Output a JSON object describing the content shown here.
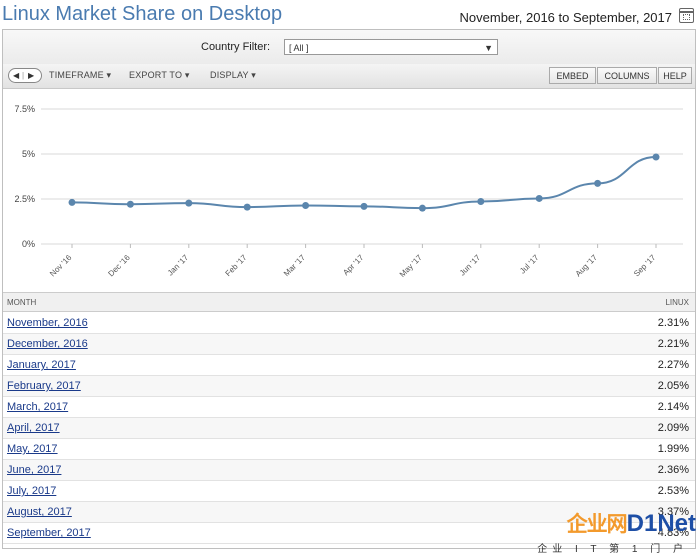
{
  "header": {
    "title": "Linux Market Share on Desktop",
    "date_range": "November, 2016 to September, 2017"
  },
  "filter": {
    "label": "Country Filter:",
    "selected": "[ All ]"
  },
  "toolbar": {
    "timeframe": "TIMEFRAME",
    "export_to": "EXPORT TO",
    "display": "DISPLAY",
    "embed": "EMBED",
    "columns": "COLUMNS",
    "help": "HELP"
  },
  "table": {
    "col_month": "MONTH",
    "col_linux": "LINUX",
    "rows": [
      {
        "month": "November, 2016",
        "value": "2.31%"
      },
      {
        "month": "December, 2016",
        "value": "2.21%"
      },
      {
        "month": "January, 2017",
        "value": "2.27%"
      },
      {
        "month": "February, 2017",
        "value": "2.05%"
      },
      {
        "month": "March, 2017",
        "value": "2.14%"
      },
      {
        "month": "April, 2017",
        "value": "2.09%"
      },
      {
        "month": "May, 2017",
        "value": "1.99%"
      },
      {
        "month": "June, 2017",
        "value": "2.36%"
      },
      {
        "month": "July, 2017",
        "value": "2.53%"
      },
      {
        "month": "August, 2017",
        "value": "3.37%"
      },
      {
        "month": "September, 2017",
        "value": "4.83%"
      }
    ]
  },
  "chart_data": {
    "type": "line",
    "categories": [
      "Nov '16",
      "Dec '16",
      "Jan '17",
      "Feb '17",
      "Mar '17",
      "Apr '17",
      "May '17",
      "Jun '17",
      "Jul '17",
      "Aug '17",
      "Sep '17"
    ],
    "series": [
      {
        "values": [
          2.31,
          2.21,
          2.27,
          2.05,
          2.14,
          2.09,
          1.99,
          2.36,
          2.53,
          3.37,
          4.83
        ]
      }
    ],
    "yticks": [
      "0%",
      "2.5%",
      "5%",
      "7.5%"
    ],
    "ytick_values": [
      0,
      2.5,
      5,
      7.5
    ],
    "ylim": [
      0,
      7.5
    ],
    "grid": true,
    "line_color": "#5b86ad"
  },
  "watermark": {
    "brand_cn": "企业网",
    "brand_en": "D1Net",
    "subtitle": "企业 I T 第 1 门 户"
  }
}
